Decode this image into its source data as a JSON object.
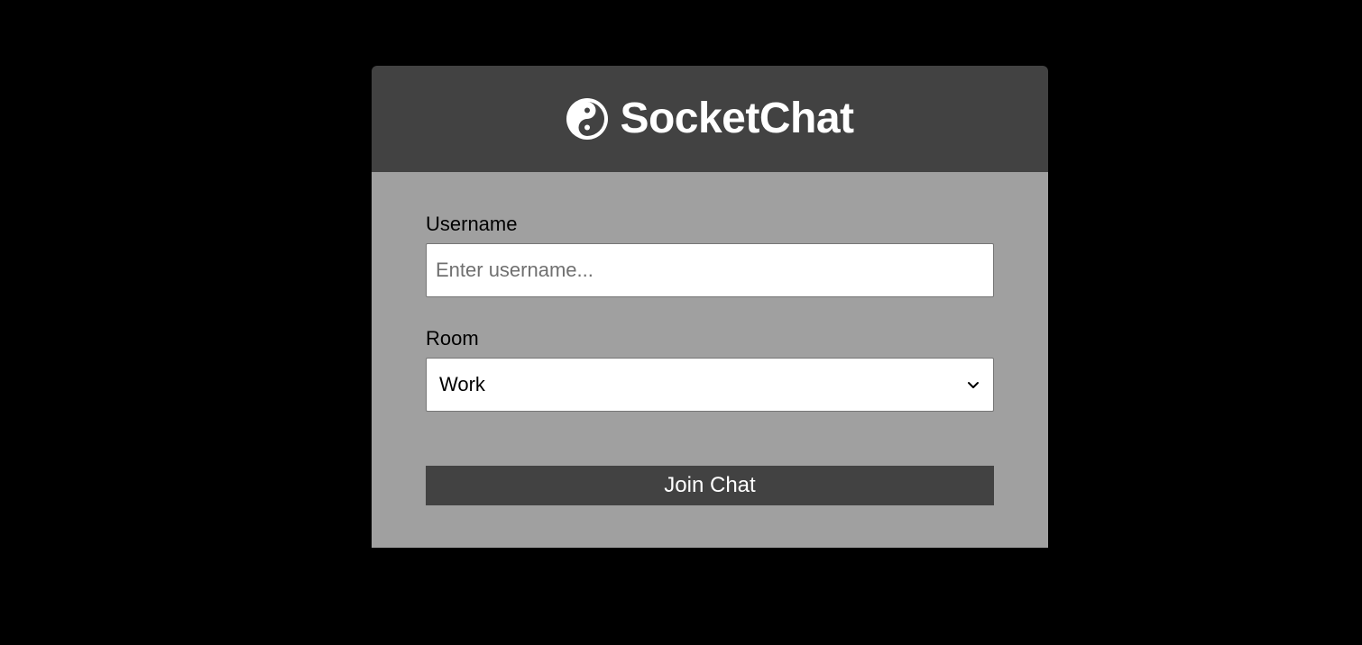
{
  "header": {
    "brand": "SocketChat",
    "logo_icon": "yin-yang-icon"
  },
  "form": {
    "username_label": "Username",
    "username_placeholder": "Enter username...",
    "username_value": "",
    "room_label": "Room",
    "room_selected": "Work",
    "submit_label": "Join Chat"
  },
  "colors": {
    "background": "#000000",
    "header_bg": "#424242",
    "body_bg": "#a0a0a0",
    "button_bg": "#424242",
    "text_light": "#ffffff"
  }
}
